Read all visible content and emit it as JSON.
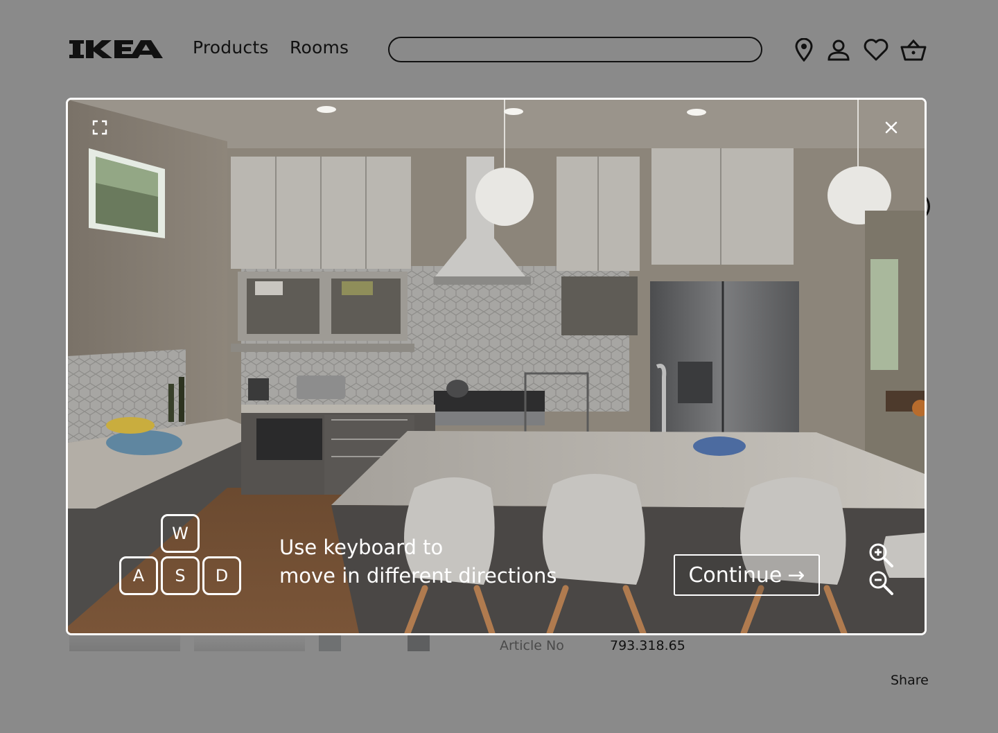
{
  "header": {
    "logo_text": "IKEA",
    "nav": [
      {
        "label": "Products"
      },
      {
        "label": "Rooms"
      }
    ],
    "search": {
      "value": "",
      "placeholder": ""
    },
    "icons": [
      "location-pin-icon",
      "account-icon",
      "heart-icon",
      "basket-icon"
    ]
  },
  "product": {
    "article_label": "Article No",
    "article_value": "793.318.65",
    "share_label": "Share"
  },
  "viewer": {
    "scene": "kitchen-360-panorama",
    "hint_line1": "Use keyboard to",
    "hint_line2": "move in different directions",
    "keys": [
      "W",
      "A",
      "S",
      "D"
    ],
    "continue_label": "Continue",
    "continue_arrow": "→",
    "controls": [
      "fullscreen-icon",
      "close-icon",
      "zoom-in-icon",
      "zoom-out-icon"
    ]
  },
  "colors": {
    "overlay_bg": "#8a8a8a",
    "frame": "#ffffff",
    "text_dark": "#111111"
  }
}
